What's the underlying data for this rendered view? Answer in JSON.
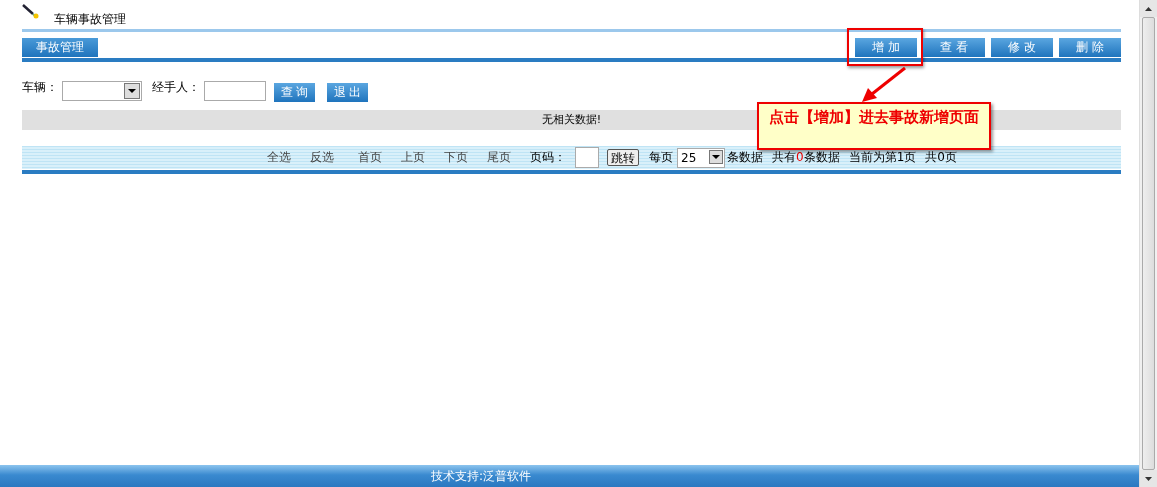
{
  "page_title": "车辆事故管理",
  "tab": {
    "label": "事故管理",
    "selected": true
  },
  "toolbar_buttons": [
    {
      "label": "增 加",
      "highlighted": true
    },
    {
      "label": "查 看",
      "highlighted": false
    },
    {
      "label": "修 改",
      "highlighted": false
    },
    {
      "label": "删 除",
      "highlighted": false
    }
  ],
  "filters": [
    {
      "label": "车辆：",
      "kind": "select"
    },
    {
      "label": "经手人：",
      "kind": "text"
    }
  ],
  "filter_buttons": [
    "查 询",
    "退 出"
  ],
  "empty_message": "无相关数据!",
  "pager": {
    "links": [
      "全选",
      "反选",
      "首页",
      "上页",
      "下页",
      "尾页"
    ],
    "page_label": "页码：",
    "jump_button": "跳转",
    "per_page_label": "每页",
    "per_page": "25",
    "per_page_suffix": "条数据",
    "total": "共有**0**条数据",
    "current": "当前为第1页",
    "pages": "共0页"
  },
  "annotation": {
    "text": "点击【增加】进去事故新增页面"
  },
  "footer": "技术支持:泛普软件"
}
